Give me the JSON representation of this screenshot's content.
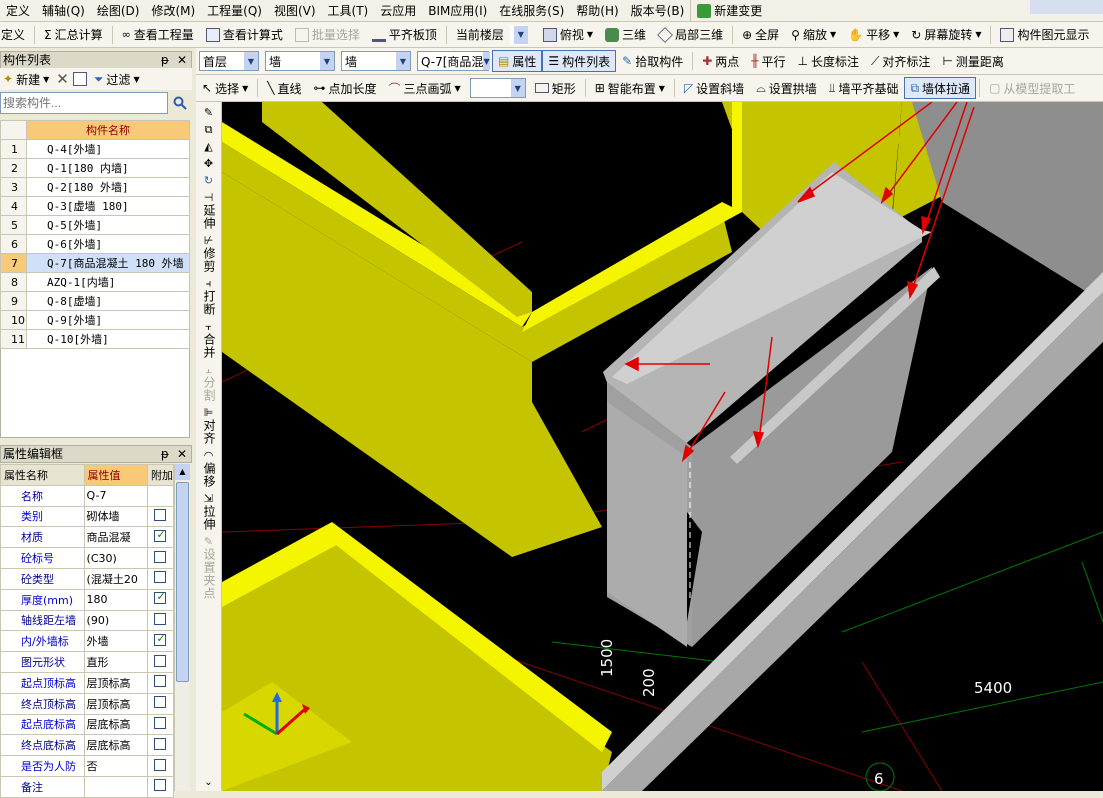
{
  "menubar": {
    "items": [
      "定义",
      "辅轴(Q)",
      "绘图(D)",
      "修改(M)",
      "工程量(Q)",
      "视图(V)",
      "工具(T)",
      "云应用",
      "BIM应用(I)",
      "在线服务(S)",
      "帮助(H)",
      "版本号(B)"
    ],
    "new_change": "新建变更"
  },
  "toolbar1": {
    "define": "定义",
    "sum": "汇总计算",
    "view_qty": "查看工程量",
    "view_formula": "查看计算式",
    "batch_select": "批量选择",
    "align_slab": "平齐板顶",
    "current_floor": "当前楼层",
    "top_view": "俯视",
    "three_d": "三维",
    "local_3d": "局部三维",
    "fullscreen": "全屏",
    "zoom": "缩放",
    "pan": "平移",
    "rotate": "屏幕旋转",
    "show_elements": "构件图元显示"
  },
  "toolbar2": {
    "floor": "首层",
    "category": "墙",
    "type": "墙",
    "component": "Q-7[商品混",
    "property": "属性",
    "comp_list": "构件列表",
    "pick": "拾取构件",
    "two_points": "两点",
    "parallel": "平行",
    "length_mark": "长度标注",
    "align_mark": "对齐标注",
    "measure": "测量距离"
  },
  "toolbar3": {
    "select": "选择",
    "line": "直线",
    "point_len": "点加长度",
    "arc3": "三点画弧",
    "rect": "矩形",
    "smart": "智能布置",
    "slope_wall": "设置斜墙",
    "arch_wall": "设置拱墙",
    "wall_base": "墙平齐基础",
    "wall_extend": "墙体拉通",
    "extract": "从模型提取工"
  },
  "complist": {
    "title": "构件列表",
    "new": "新建",
    "filter": "过滤",
    "search_placeholder": "搜索构件...",
    "col_name": "构件名称",
    "rows": [
      {
        "n": "1",
        "name": "Q-4[外墙]"
      },
      {
        "n": "2",
        "name": "Q-1[180 内墙]"
      },
      {
        "n": "3",
        "name": "Q-2[180 外墙]"
      },
      {
        "n": "4",
        "name": "Q-3[虚墙 180]"
      },
      {
        "n": "5",
        "name": "Q-5[外墙]"
      },
      {
        "n": "6",
        "name": "Q-6[外墙]"
      },
      {
        "n": "7",
        "name": "Q-7[商品混凝土 180 外墙"
      },
      {
        "n": "8",
        "name": "AZQ-1[内墙]"
      },
      {
        "n": "9",
        "name": "Q-8[虚墙]"
      },
      {
        "n": "10",
        "name": "Q-9[外墙]"
      },
      {
        "n": "11",
        "name": "Q-10[外墙]"
      }
    ],
    "selected_row": 7
  },
  "props": {
    "title": "属性编辑框",
    "col_name": "属性名称",
    "col_value": "属性值",
    "col_attach": "附加",
    "rows": [
      {
        "k": "名称",
        "v": "Q-7",
        "c": null
      },
      {
        "k": "类别",
        "v": "砌体墙",
        "c": false
      },
      {
        "k": "材质",
        "v": "商品混凝",
        "c": true
      },
      {
        "k": "砼标号",
        "v": "(C30)",
        "c": false
      },
      {
        "k": "砼类型",
        "v": "(混凝土20",
        "c": false
      },
      {
        "k": "厚度(mm)",
        "v": "180",
        "c": true
      },
      {
        "k": "轴线距左墙",
        "v": "(90)",
        "c": false
      },
      {
        "k": "内/外墙标",
        "v": "外墙",
        "c": true
      },
      {
        "k": "图元形状",
        "v": "直形",
        "c": false
      },
      {
        "k": "起点顶标高",
        "v": "层顶标高",
        "c": false
      },
      {
        "k": "终点顶标高",
        "v": "层顶标高",
        "c": false
      },
      {
        "k": "起点底标高",
        "v": "层底标高",
        "c": false
      },
      {
        "k": "终点底标高",
        "v": "层底标高",
        "c": false
      },
      {
        "k": "是否为人防",
        "v": "否",
        "c": false
      },
      {
        "k": "备注",
        "v": "",
        "c": false
      }
    ]
  },
  "vtools": {
    "extend": "延伸",
    "trim": "修剪",
    "break": "打断",
    "merge": "合并",
    "split": "分割",
    "align": "对齐",
    "offset": "偏移",
    "stretch": "拉伸",
    "set_pivot": "设置夹点"
  },
  "viewport": {
    "dim_1500": "1500",
    "dim_200": "200",
    "dim_5400": "5400",
    "axis_6": "6"
  },
  "colors": {
    "wall_yellow": "#c4c400",
    "wall_edge": "#f5f500",
    "wall_gray": "#a8a8a8",
    "annotation_red": "#e00000",
    "grid_green": "#008a00"
  }
}
